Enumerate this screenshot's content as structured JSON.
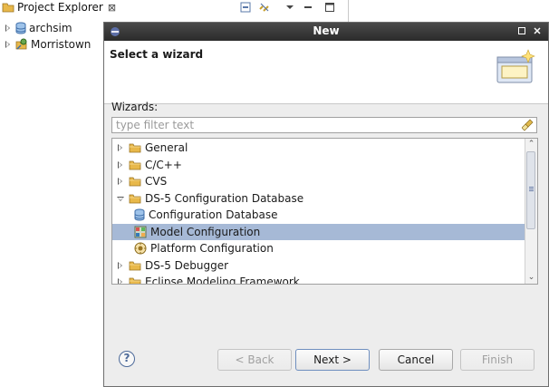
{
  "project_explorer": {
    "title": "Project Explorer",
    "close_glyph": "⊠",
    "items": [
      {
        "label": "archsim",
        "icon": "database-project-icon"
      },
      {
        "label": "Morristown",
        "icon": "connected-project-icon"
      }
    ]
  },
  "dialog": {
    "title": "New",
    "header_title": "Select a wizard",
    "wizards_label": "Wizards:",
    "filter_placeholder": "type filter text",
    "filter_value": "",
    "tree": [
      {
        "label": "General",
        "level": 0,
        "twisty": "right",
        "icon": "folder-icon"
      },
      {
        "label": "C/C++",
        "level": 0,
        "twisty": "right",
        "icon": "folder-icon"
      },
      {
        "label": "CVS",
        "level": 0,
        "twisty": "right",
        "icon": "folder-icon"
      },
      {
        "label": "DS-5 Configuration Database",
        "level": 0,
        "twisty": "down",
        "icon": "folder-icon"
      },
      {
        "label": "Configuration Database",
        "level": 1,
        "twisty": "",
        "icon": "database-icon"
      },
      {
        "label": "Model Configuration",
        "level": 1,
        "twisty": "",
        "icon": "model-icon",
        "selected": true
      },
      {
        "label": "Platform Configuration",
        "level": 1,
        "twisty": "",
        "icon": "platform-icon"
      },
      {
        "label": "DS-5 Debugger",
        "level": 0,
        "twisty": "right",
        "icon": "folder-icon"
      },
      {
        "label": "Eclipse Modeling Framework",
        "level": 0,
        "twisty": "right",
        "icon": "folder-icon"
      }
    ],
    "buttons": {
      "back": "< Back",
      "next": "Next >",
      "cancel": "Cancel",
      "finish": "Finish"
    }
  },
  "colors": {
    "selection": "#a6b9d6",
    "titlebar": "#2b2b2b",
    "folder": "#e8b84a"
  }
}
